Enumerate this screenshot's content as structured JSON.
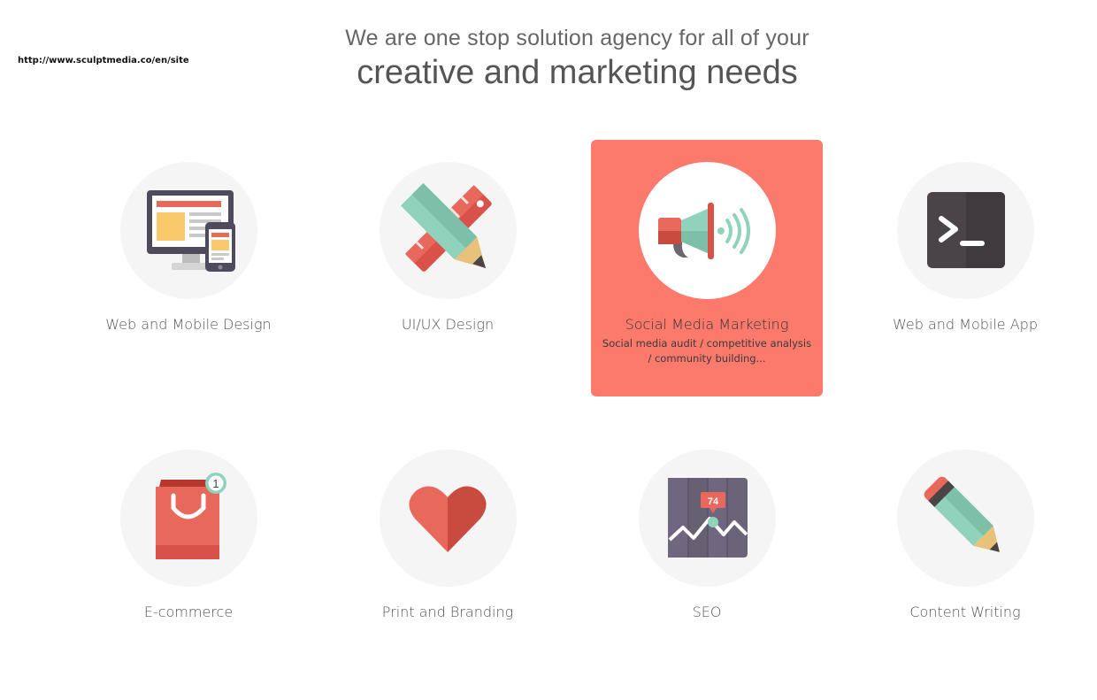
{
  "url_text": "http://www.sculptmedia.co/en/site",
  "headline": {
    "line1": "We are one stop solution agency for all of your",
    "line2": "creative and marketing needs"
  },
  "colors": {
    "accent": "#fc7a6c",
    "circle_bg": "#f5f5f5",
    "red": "#e8685b",
    "dark_red": "#c94a3e",
    "mint": "#8fd3bd",
    "dark_grey": "#4a4448"
  },
  "services": [
    {
      "title": "Web and Mobile Design",
      "icon": "devices-icon"
    },
    {
      "title": "UI/UX Design",
      "icon": "pencil-ruler-icon"
    },
    {
      "title": "Social Media Marketing",
      "icon": "megaphone-icon",
      "active": true,
      "description": "Social media audit / competitive analysis / community building..."
    },
    {
      "title": "Web and Mobile App",
      "icon": "terminal-icon"
    },
    {
      "title": "E-commerce",
      "icon": "shopping-bag-icon",
      "badge": "1"
    },
    {
      "title": "Print and Branding",
      "icon": "heart-icon"
    },
    {
      "title": "SEO",
      "icon": "analytics-chart-icon",
      "badge": "74"
    },
    {
      "title": "Content Writing",
      "icon": "pencil-icon"
    }
  ]
}
